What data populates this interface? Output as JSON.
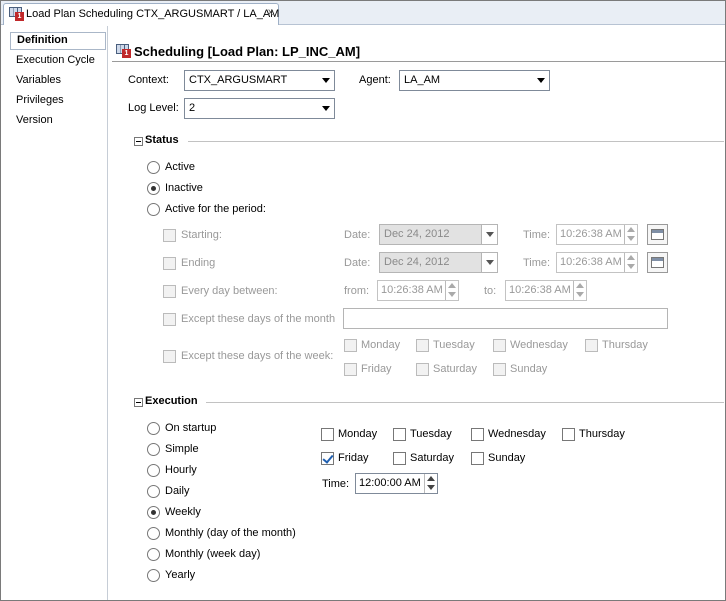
{
  "tab": {
    "title": "Load Plan Scheduling CTX_ARGUSMART / LA_AM",
    "close": "x"
  },
  "sidebar": {
    "items": [
      "Definition",
      "Execution Cycle",
      "Variables",
      "Privileges",
      "Version"
    ]
  },
  "heading": "Scheduling [Load Plan: LP_INC_AM]",
  "form": {
    "context_label": "Context:",
    "context_value": "CTX_ARGUSMART",
    "agent_label": "Agent:",
    "agent_value": "LA_AM",
    "loglevel_label": "Log Level:",
    "loglevel_value": "2"
  },
  "status": {
    "title": "Status",
    "options": [
      "Active",
      "Inactive",
      "Active for the period:"
    ],
    "selected": "Inactive",
    "starting_label": "Starting:",
    "ending_label": "Ending",
    "date_label": "Date:",
    "time_label": "Time:",
    "starting_date": "Dec 24, 2012",
    "starting_time": "10:26:38 AM",
    "ending_date": "Dec 24, 2012",
    "ending_time": "10:26:38 AM",
    "every_day_label": "Every day between:",
    "from_label": "from:",
    "from_time": "10:26:38 AM",
    "to_label": "to:",
    "to_time": "10:26:38 AM",
    "except_month_label": "Except these days of the month",
    "except_week_label": "Except these days of the week:",
    "weekdays": [
      "Monday",
      "Tuesday",
      "Wednesday",
      "Thursday",
      "Friday",
      "Saturday",
      "Sunday"
    ]
  },
  "execution": {
    "title": "Execution",
    "options": [
      "On startup",
      "Simple",
      "Hourly",
      "Daily",
      "Weekly",
      "Monthly (day of the month)",
      "Monthly (week day)",
      "Yearly"
    ],
    "selected": "Weekly",
    "days": [
      "Monday",
      "Tuesday",
      "Wednesday",
      "Thursday",
      "Friday",
      "Saturday",
      "Sunday"
    ],
    "checked_days": [
      "Friday"
    ],
    "time_label": "Time:",
    "time_value": "12:00:00 AM"
  },
  "icons": {
    "tab": "load-plan-icon",
    "heading": "load-plan-icon",
    "calendar": "calendar-icon"
  }
}
